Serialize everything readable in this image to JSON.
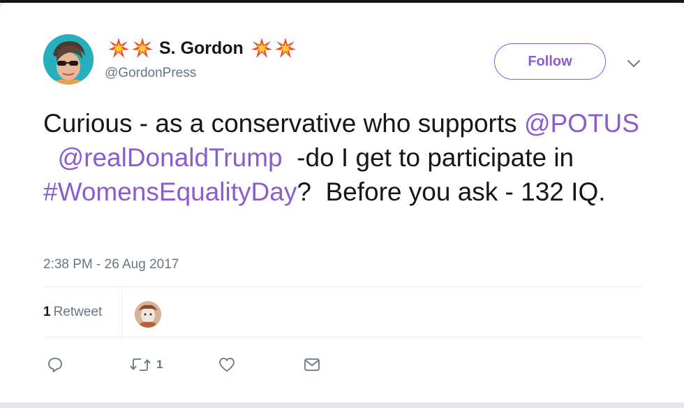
{
  "user": {
    "display_name": "S. Gordon",
    "handle": "@GordonPress",
    "name_decoration_icon": "collision-emoji-icon"
  },
  "follow_button": {
    "label": "Follow"
  },
  "tweet": {
    "segments": [
      {
        "text": "Curious - as a conservative who supports ",
        "link": false
      },
      {
        "text": "@POTUS",
        "link": true
      },
      {
        "text": "  ",
        "link": false
      },
      {
        "text": "@realDonaldTrump",
        "link": true
      },
      {
        "text": "  -do I get to participate in ",
        "link": false
      },
      {
        "text": "#WomensEqualityDay",
        "link": true
      },
      {
        "text": "?  Before you ask - 132 IQ.",
        "link": false
      }
    ],
    "timestamp": "2:38 PM - 26 Aug 2017"
  },
  "stats": {
    "retweet_count": "1",
    "retweet_label": "Retweet"
  },
  "actions": {
    "reply_icon": "reply-icon",
    "retweet_icon": "retweet-icon",
    "retweet_count": "1",
    "like_icon": "heart-icon",
    "dm_icon": "envelope-icon"
  },
  "colors": {
    "link": "#8c5bd0",
    "text": "#14171a",
    "muted": "#657786",
    "divider": "#e6ecf0"
  }
}
